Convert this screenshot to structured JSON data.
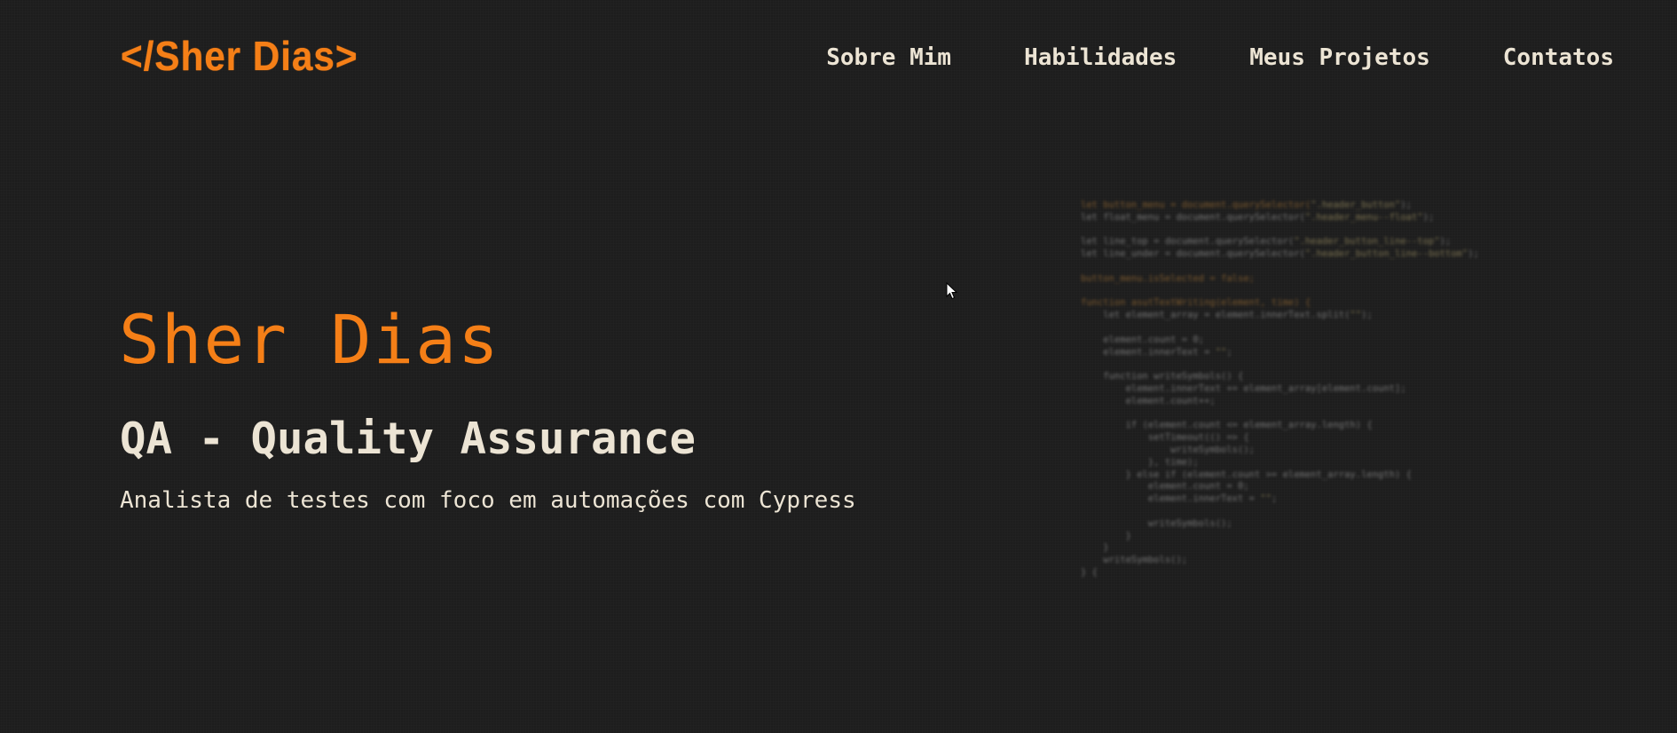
{
  "header": {
    "logo": "</Sher Dias>",
    "nav": [
      {
        "label": "Sobre Mim"
      },
      {
        "label": "Habilidades"
      },
      {
        "label": "Meus Projetos"
      },
      {
        "label": "Contatos"
      }
    ]
  },
  "hero": {
    "name": "Sher Dias",
    "role": "QA - Quality Assurance",
    "description": "Analista de testes com foco em automações com Cypress"
  },
  "code_image": {
    "lines": [
      "let button_menu = document.querySelector(\".header_button\");",
      "let float_menu = document.querySelector(\".header_menu--float\");",
      "",
      "let line_top = document.querySelector(\".header_button_line--top\");",
      "let line_under = document.querySelector(\".header_button_line--bottom\");",
      "",
      "button_menu.isSelected = false;",
      "",
      "function asutTextWriting(element, time) {",
      "    let element_array = element.innerText.split(\"\");",
      "",
      "    element.count = 0;",
      "    element.innerText = \"\";",
      "",
      "    function writeSymbols() {",
      "        element.innerText += element_array[element.count];",
      "        element.count++;",
      "",
      "        if (element.count <= element_array.length) {",
      "            setTimeout(() => {",
      "                writeSymbols();",
      "            }, time);",
      "        } else if (element.count >= element_array.length) {",
      "            element.count = 0;",
      "            element.innerText = \"\";",
      "",
      "            writeSymbols();",
      "        }",
      "    }",
      "    writeSymbols();",
      "} {"
    ]
  },
  "colors": {
    "accent": "#f57f17",
    "text": "#ece4d4",
    "background": "#1d1d1d"
  },
  "icons": {
    "cursor": "mouse-pointer-icon"
  }
}
